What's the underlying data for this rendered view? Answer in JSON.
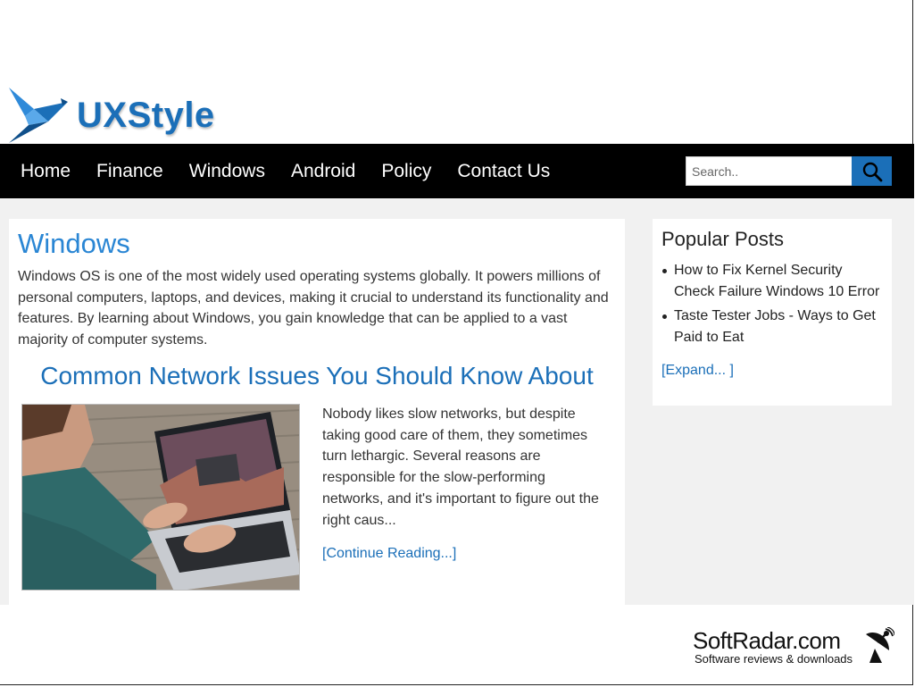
{
  "site": {
    "logo_text": "UXStyle"
  },
  "nav": {
    "items": [
      {
        "label": "Home"
      },
      {
        "label": "Finance"
      },
      {
        "label": "Windows"
      },
      {
        "label": "Android"
      },
      {
        "label": "Policy"
      },
      {
        "label": "Contact Us"
      }
    ],
    "search_placeholder": "Search.."
  },
  "main": {
    "section_title": "Windows",
    "section_description": "Windows OS is one of the most widely used operating systems globally. It powers millions of personal computers, laptops, and devices, making it crucial to understand its functionality and features. By learning about Windows, you gain knowledge that can be applied to a vast majority of computer systems.",
    "article": {
      "title": "Common Network Issues You Should Know About",
      "excerpt": "Nobody likes slow networks, but despite taking good care of them, they sometimes turn lethargic. Several reasons are responsible for the slow-performing networks, and it's important to figure out the right caus...",
      "continue_label": "[Continue Reading...]"
    }
  },
  "sidebar": {
    "title": "Popular Posts",
    "posts": [
      {
        "label": "How to Fix Kernel Security Check Failure Windows 10 Error"
      },
      {
        "label": "Taste Tester Jobs - Ways to Get Paid to Eat"
      }
    ],
    "expand_label": "[Expand... ]"
  },
  "watermark": {
    "title": "SoftRadar.com",
    "subtitle": "Software reviews & downloads"
  },
  "colors": {
    "brand_blue": "#1b6fb8",
    "section_blue": "#2a86d4",
    "nav_bg": "#000000",
    "content_bg": "#f1f1f1"
  },
  "icons": {
    "logo": "origami-bird-icon",
    "search": "search-icon",
    "watermark": "satellite-dish-icon"
  }
}
